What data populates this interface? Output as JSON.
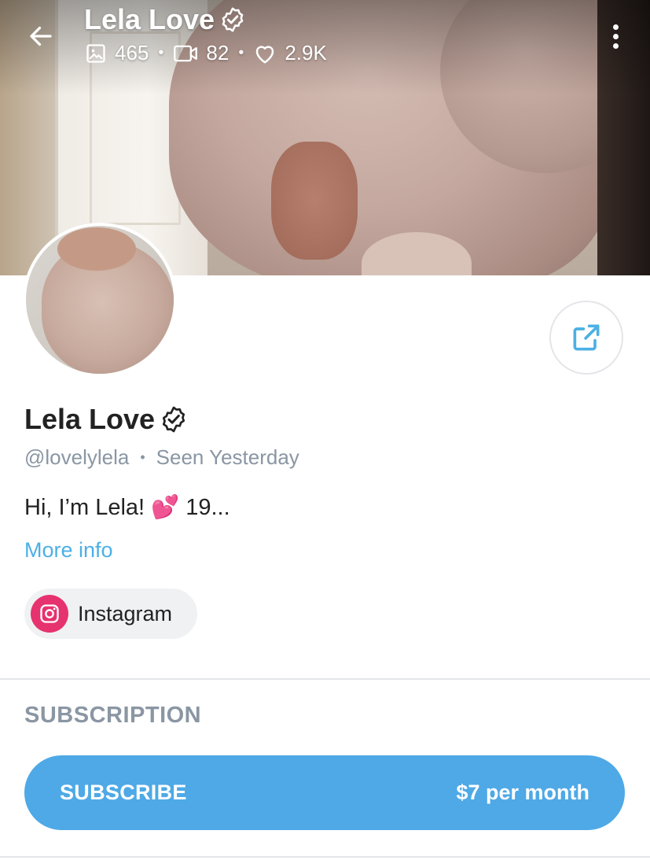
{
  "header": {
    "name": "Lela Love",
    "stats": [
      {
        "icon": "image-icon",
        "value": "465"
      },
      {
        "icon": "video-icon",
        "value": "82"
      },
      {
        "icon": "heart-icon",
        "value": "2.9K"
      }
    ],
    "separator": "•"
  },
  "profile": {
    "name": "Lela Love",
    "handle": "@lovelylela",
    "separator": "•",
    "last_seen": "Seen Yesterday",
    "bio_start": "Hi, I’m Lela!",
    "bio_emoji": "💕",
    "bio_end": "19...",
    "more_info": "More info"
  },
  "social": {
    "label": "Instagram",
    "icon": "instagram-icon",
    "color": "#e6326e"
  },
  "subscription": {
    "section_title": "SUBSCRIPTION",
    "button_label": "SUBSCRIBE",
    "price": "$7 per month",
    "accent": "#4ea9e6"
  },
  "colors": {
    "link": "#4cb0e4",
    "muted": "#8a96a3"
  }
}
